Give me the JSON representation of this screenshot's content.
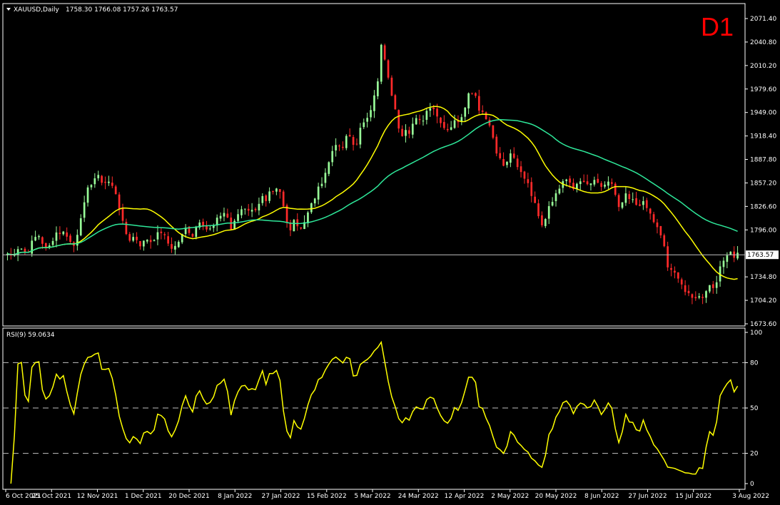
{
  "window": {
    "symbol_title": "XAUUSD,Daily",
    "ohlc": "1758.30 1766.08 1757.26 1763.57",
    "timeframe": "D1"
  },
  "colors": {
    "background": "#000000",
    "axis": "#ffffff",
    "grid": "#c0c0c0",
    "bull_candle": "#98fb98",
    "bear_candle": "#ff2a2a",
    "ma_fast": "#ffff00",
    "ma_slow": "#2ee89a",
    "rsi_line": "#ffff00",
    "timeframe_label": "#ff0000"
  },
  "chart_data": [
    {
      "type": "candlestick",
      "symbol": "XAUUSD",
      "period": "Daily",
      "y_ticks": [
        "2071.40",
        "2040.80",
        "2010.20",
        "1979.60",
        "1949.00",
        "1918.40",
        "1887.80",
        "1857.20",
        "1826.60",
        "1796.00",
        "1734.80",
        "1704.20",
        "1673.60"
      ],
      "ylim": [
        1673.6,
        2071.4
      ],
      "current_price": "1763.57",
      "x_labels": [
        "6 Oct 2021",
        "25 Oct 2021",
        "12 Nov 2021",
        "1 Dec 2021",
        "20 Dec 2021",
        "8 Jan 2022",
        "27 Jan 2022",
        "15 Feb 2022",
        "5 Mar 2022",
        "24 Mar 2022",
        "12 Apr 2022",
        "2 May 2022",
        "20 May 2022",
        "8 Jun 2022",
        "27 Jun 2022",
        "15 Jul 2022",
        "3 Aug 2022"
      ],
      "close_path": [
        1765,
        1762,
        1768,
        1775,
        1770,
        1765,
        1776,
        1785,
        1790,
        1780,
        1771,
        1775,
        1788,
        1795,
        1791,
        1794,
        1783,
        1772,
        1790,
        1815,
        1830,
        1852,
        1860,
        1866,
        1862,
        1857,
        1860,
        1853,
        1845,
        1825,
        1800,
        1788,
        1782,
        1790,
        1777,
        1778,
        1785,
        1781,
        1786,
        1790,
        1795,
        1782,
        1776,
        1771,
        1779,
        1786,
        1798,
        1795,
        1789,
        1803,
        1811,
        1800,
        1795,
        1798,
        1806,
        1815,
        1819,
        1812,
        1795,
        1808,
        1821,
        1825,
        1826,
        1819,
        1823,
        1831,
        1838,
        1830,
        1845,
        1842,
        1850,
        1838,
        1810,
        1795,
        1812,
        1802,
        1800,
        1808,
        1820,
        1833,
        1843,
        1855,
        1868,
        1880,
        1898,
        1910,
        1900,
        1904,
        1920,
        1915,
        1900,
        1925,
        1930,
        1942,
        1955,
        1975,
        1990,
        2050,
        2000,
        1985,
        1960,
        1935,
        1920,
        1930,
        1925,
        1935,
        1940,
        1935,
        1945,
        1957,
        1960,
        1945,
        1940,
        1930,
        1928,
        1932,
        1938,
        1940,
        1950,
        1970,
        1978,
        1975,
        1955,
        1950,
        1940,
        1935,
        1905,
        1890,
        1885,
        1875,
        1895,
        1890,
        1880,
        1872,
        1865,
        1850,
        1840,
        1830,
        1800,
        1810,
        1825,
        1832,
        1845,
        1850,
        1858,
        1863,
        1855,
        1850,
        1857,
        1860,
        1852,
        1855,
        1862,
        1852,
        1848,
        1860,
        1858,
        1850,
        1820,
        1830,
        1840,
        1835,
        1833,
        1828,
        1832,
        1828,
        1820,
        1810,
        1800,
        1788,
        1775,
        1745,
        1740,
        1738,
        1735,
        1718,
        1712,
        1705,
        1710,
        1708,
        1710,
        1720,
        1725,
        1720,
        1740,
        1750,
        1765,
        1770,
        1762,
        1765
      ],
      "ma_fast": {
        "lookback": 20,
        "label": ""
      },
      "ma_slow": {
        "lookback": 50,
        "label": ""
      }
    },
    {
      "type": "line",
      "indicator": "RSI(9) 59.0634",
      "ylim": [
        0,
        100
      ],
      "y_ticks": [
        "100",
        "80",
        "50",
        "20",
        "0"
      ],
      "levels": [
        80,
        50,
        20
      ]
    }
  ]
}
